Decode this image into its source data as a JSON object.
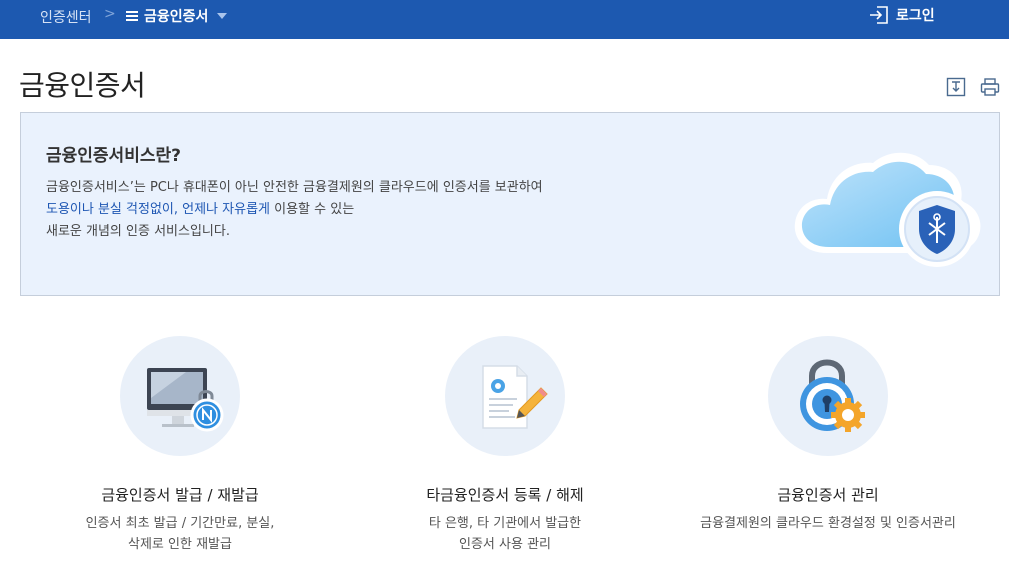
{
  "header": {
    "home": "인증센터",
    "separator": ">",
    "menu_label": "금융인증서",
    "login_label": "로그인"
  },
  "page": {
    "title": "금융인증서"
  },
  "intro": {
    "title": "금융인증서비스란?",
    "line1": "금융인증서비스’는 PC나 휴대폰이 아닌 안전한 금융결제원의 클라우드에 인증서를 보관하여",
    "line2_hl1": "도용이나 분실 걱정없이",
    "line2_comma": ", ",
    "line2_hl2": "언제나 자유롭게",
    "line2_rest": " 이용할 수 있는",
    "line3": "새로운 개념의 인증 서비스입니다."
  },
  "features": [
    {
      "title": "금융인증서 발급 / 재발급",
      "desc1": "인증서 최초 발급 / 기간만료, 분실,",
      "desc2": "삭제로 인한 재발급"
    },
    {
      "title": "타금융인증서 등록 / 해제",
      "desc1": "타 은행, 타 기관에서 발급한",
      "desc2": "인증서 사용 관리"
    },
    {
      "title": "금융인증서 관리",
      "desc1": "금융결제원의 클라우드 환경설정 및 인증서관리",
      "desc2": ""
    }
  ],
  "colors": {
    "header_bg": "#1d59b0",
    "accent": "#1f57b3",
    "intro_bg": "#eaf2fd",
    "circle_bg": "#e9f0f9"
  },
  "icons": [
    "menu-icon",
    "login-icon",
    "download-icon",
    "print-icon",
    "cloud-shield-icon",
    "monitor-lock-icon",
    "document-pen-icon",
    "padlock-gear-icon"
  ]
}
